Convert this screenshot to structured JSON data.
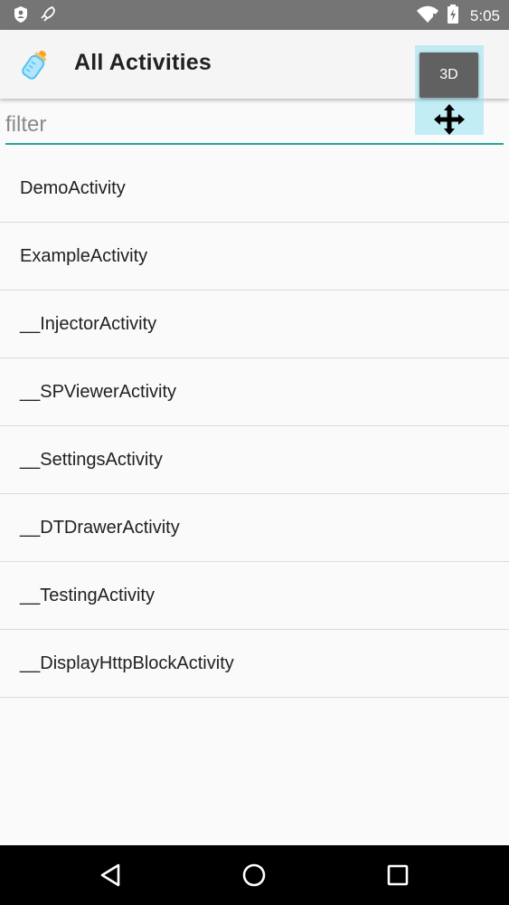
{
  "status_bar": {
    "left_icons": [
      "shield-icon",
      "rocket-icon"
    ],
    "right_icons": [
      "wifi-icon",
      "battery-charging-icon"
    ],
    "time": "5:05"
  },
  "app_bar": {
    "icon": "baby-bottle-icon",
    "title": "All Activities"
  },
  "overlay": {
    "button_label": "3D",
    "icon": "move-icon"
  },
  "filter": {
    "placeholder": "filter",
    "value": ""
  },
  "activities": [
    {
      "label": "DemoActivity"
    },
    {
      "label": "ExampleActivity"
    },
    {
      "label": "__InjectorActivity"
    },
    {
      "label": "__SPViewerActivity"
    },
    {
      "label": "__SettingsActivity"
    },
    {
      "label": "__DTDrawerActivity"
    },
    {
      "label": "__TestingActivity"
    },
    {
      "label": "__DisplayHttpBlockActivity"
    }
  ],
  "nav_bar": {
    "buttons": [
      "back-icon",
      "home-icon",
      "recents-icon"
    ]
  },
  "colors": {
    "status_bar": "#757575",
    "accent": "#26a69a",
    "overlay": "#96e1f0"
  }
}
